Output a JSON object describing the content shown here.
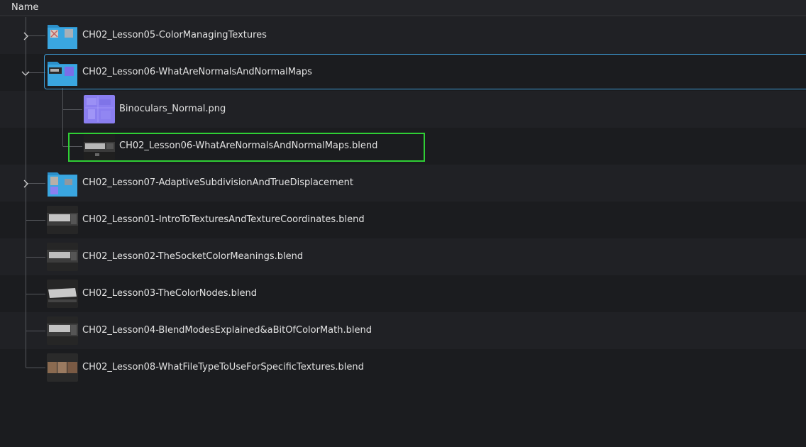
{
  "header": {
    "name_label": "Name"
  },
  "items": [
    {
      "label": "CH02_Lesson05-ColorManagingTextures"
    },
    {
      "label": "CH02_Lesson06-WhatAreNormalsAndNormalMaps"
    },
    {
      "label": "Binoculars_Normal.png"
    },
    {
      "label": "CH02_Lesson06-WhatAreNormalsAndNormalMaps.blend"
    },
    {
      "label": "CH02_Lesson07-AdaptiveSubdivisionAndTrueDisplacement"
    },
    {
      "label": "CH02_Lesson01-IntroToTexturesAndTextureCoordinates.blend"
    },
    {
      "label": "CH02_Lesson02-TheSocketColorMeanings.blend"
    },
    {
      "label": "CH02_Lesson03-TheColorNodes.blend"
    },
    {
      "label": "CH02_Lesson04-BlendModesExplained&aBitOfColorMath.blend"
    },
    {
      "label": "CH02_Lesson08-WhatFileTypeToUseForSpecificTextures.blend"
    }
  ],
  "colors": {
    "folder": "#3aa6e0",
    "selection_border": "#3c9bd4",
    "highlight_border": "#2fcf35"
  }
}
